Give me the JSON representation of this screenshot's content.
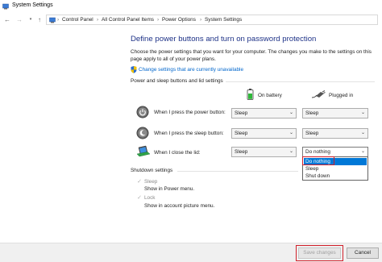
{
  "window": {
    "title": "System Settings"
  },
  "address": {
    "crumbs": [
      "Control Panel",
      "All Control Panel Items",
      "Power Options",
      "System Settings"
    ]
  },
  "page": {
    "heading": "Define power buttons and turn on password protection",
    "description": "Choose the power settings that you want for your computer. The changes you make to the settings on this page apply to all of your power plans.",
    "link": "Change settings that are currently unavailable"
  },
  "power_section": {
    "label": "Power and sleep buttons and lid settings",
    "columns": {
      "battery": "On battery",
      "plugged": "Plugged in"
    },
    "rows": [
      {
        "label": "When I press the power button:",
        "battery": "Sleep",
        "plugged": "Sleep",
        "icon": "power-button-icon"
      },
      {
        "label": "When I press the sleep button:",
        "battery": "Sleep",
        "plugged": "Sleep",
        "icon": "sleep-button-icon"
      },
      {
        "label": "When I close the lid:",
        "battery": "Sleep",
        "plugged": "Do nothing",
        "icon": "laptop-lid-icon"
      }
    ],
    "open_dropdown_options": [
      "Do nothing",
      "Sleep",
      "Shut down"
    ],
    "open_dropdown_selected": "Do nothing"
  },
  "shutdown_section": {
    "label": "Shutdown settings",
    "items": [
      {
        "label": "Sleep",
        "sub": "Show in Power menu.",
        "checked": true
      },
      {
        "label": "Lock",
        "sub": "Show in account picture menu.",
        "checked": true
      }
    ]
  },
  "footer": {
    "save": "Save changes",
    "cancel": "Cancel"
  },
  "colors": {
    "heading": "#1e3287",
    "link": "#0066cc",
    "selection": "#0078d7",
    "highlight": "#d0202a"
  }
}
